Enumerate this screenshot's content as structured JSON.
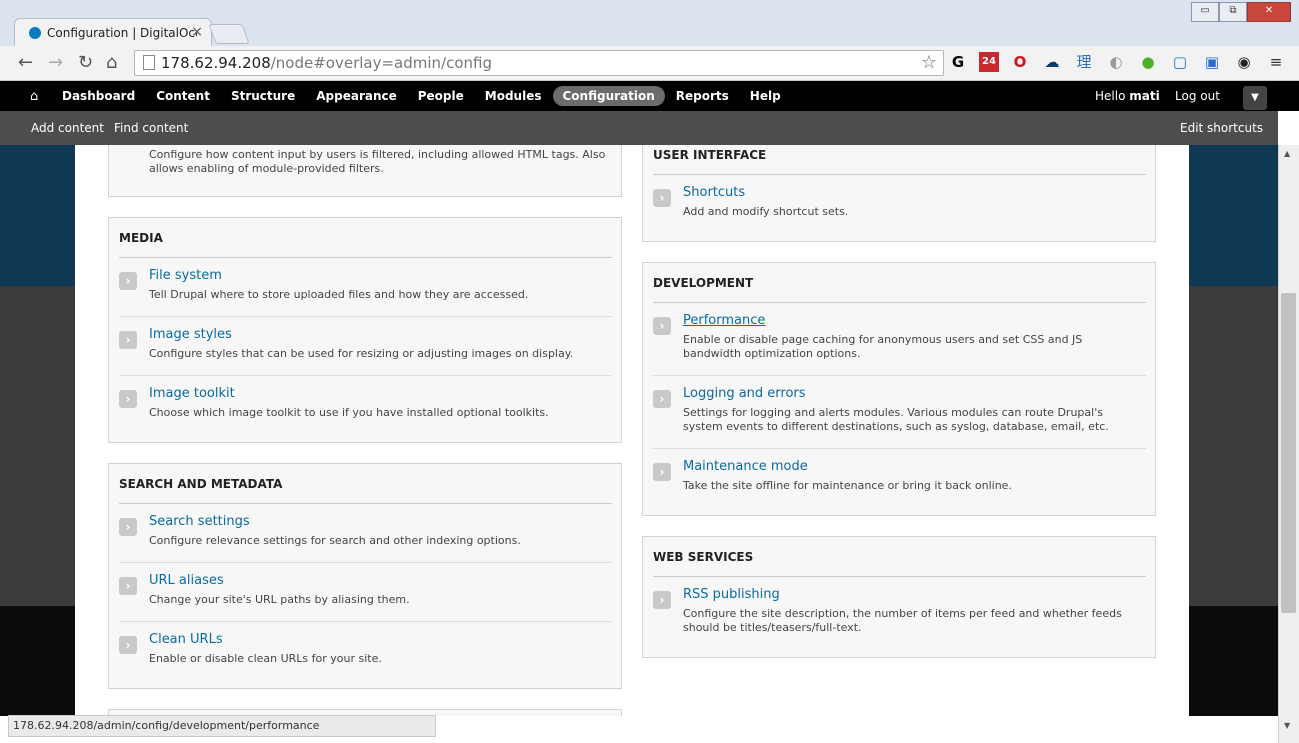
{
  "browser": {
    "tab_title": "Configuration | DigitalOce",
    "tab_close": "×",
    "url_host": "178.62.94.208",
    "url_path": "/node#overlay=admin/config",
    "status_url": "178.62.94.208/admin/config/development/performance",
    "nav": {
      "back": "←",
      "forward": "→",
      "reload": "↻",
      "home": "⌂"
    },
    "window_buttons": {
      "minimize": "▭",
      "restore": "⧉",
      "close": "✕"
    },
    "extensions": [
      "G",
      "24",
      "O",
      "☁",
      "理",
      "◐",
      "●",
      "▢",
      "▣",
      "◉",
      "≡"
    ]
  },
  "admin_toolbar": {
    "home_icon": "⌂",
    "menu": [
      "Dashboard",
      "Content",
      "Structure",
      "Appearance",
      "People",
      "Modules",
      "Configuration",
      "Reports",
      "Help"
    ],
    "active_item": "Configuration",
    "hello_prefix": "Hello ",
    "username": "mati",
    "logout": "Log out",
    "dropdown_icon": "▼"
  },
  "shortcuts": {
    "add_content": "Add content",
    "find_content": "Find content",
    "edit_shortcuts": "Edit shortcuts"
  },
  "left_column": {
    "top_partial_desc": "Configure how content input by users is filtered, including allowed HTML tags. Also allows enabling of module-provided filters.",
    "media": {
      "title": "MEDIA",
      "items": [
        {
          "title": "File system",
          "desc": "Tell Drupal where to store uploaded files and how they are accessed."
        },
        {
          "title": "Image styles",
          "desc": "Configure styles that can be used for resizing or adjusting images on display."
        },
        {
          "title": "Image toolkit",
          "desc": "Choose which image toolkit to use if you have installed optional toolkits."
        }
      ]
    },
    "search": {
      "title": "SEARCH AND METADATA",
      "items": [
        {
          "title": "Search settings",
          "desc": "Configure relevance settings for search and other indexing options."
        },
        {
          "title": "URL aliases",
          "desc": "Change your site's URL paths by aliasing them."
        },
        {
          "title": "Clean URLs",
          "desc": "Enable or disable clean URLs for your site."
        }
      ]
    }
  },
  "right_column": {
    "ui": {
      "title": "USER INTERFACE",
      "items": [
        {
          "title": "Shortcuts",
          "desc": "Add and modify shortcut sets."
        }
      ]
    },
    "development": {
      "title": "DEVELOPMENT",
      "items": [
        {
          "title": "Performance",
          "desc": "Enable or disable page caching for anonymous users and set CSS and JS bandwidth optimization options."
        },
        {
          "title": "Logging and errors",
          "desc": "Settings for logging and alerts modules. Various modules can route Drupal's system events to different destinations, such as syslog, database, email, etc."
        },
        {
          "title": "Maintenance mode",
          "desc": "Take the site offline for maintenance or bring it back online."
        }
      ]
    },
    "web_services": {
      "title": "WEB SERVICES",
      "items": [
        {
          "title": "RSS publishing",
          "desc": "Configure the site description, the number of items per feed and whether feeds should be titles/teasers/full-text."
        }
      ]
    }
  },
  "chevron": "›"
}
